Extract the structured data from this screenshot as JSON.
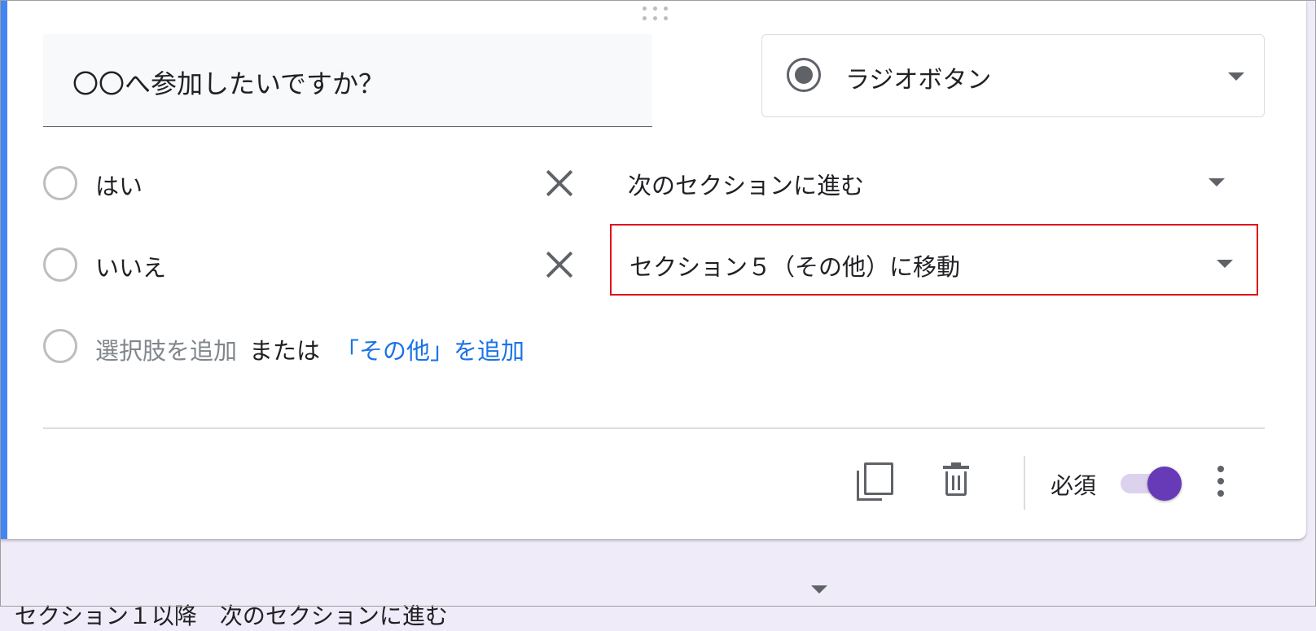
{
  "question": {
    "title": "〇〇へ参加したいですか？",
    "type_label": "ラジオボタン",
    "type_icon": "radio-button-checked-icon"
  },
  "options": [
    {
      "label": "はい",
      "goto": "次のセクションに進む",
      "highlighted": false
    },
    {
      "label": "いいえ",
      "goto": "セクション５（その他）に移動",
      "highlighted": true
    }
  ],
  "add_row": {
    "add_option": "選択肢を追加",
    "or_text": "または",
    "add_other": "「その他」を追加"
  },
  "footer": {
    "required_label": "必須",
    "required_on": true
  },
  "section_nav": {
    "label": "セクション１以降　次のセクションに進む"
  },
  "colors": {
    "accent": "#4285f4",
    "toggle": "#673ab7",
    "link": "#1a73e8",
    "highlight_border": "#e0101a",
    "page_background": "#f0ebf8"
  }
}
